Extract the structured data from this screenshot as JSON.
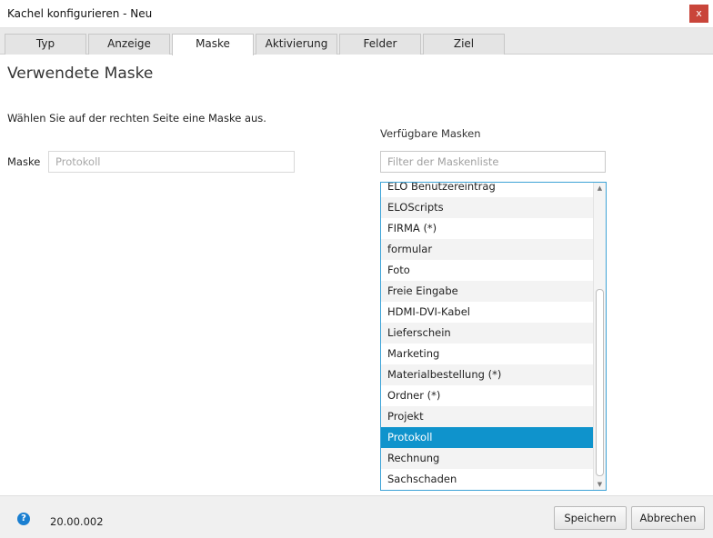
{
  "window": {
    "title": "Kachel konfigurieren - Neu",
    "close_label": "x"
  },
  "tabs": [
    {
      "label": "Typ"
    },
    {
      "label": "Anzeige"
    },
    {
      "label": "Maske"
    },
    {
      "label": "Aktivierung"
    },
    {
      "label": "Felder"
    },
    {
      "label": "Ziel"
    }
  ],
  "active_tab": "Maske",
  "page": {
    "title": "Verwendete Maske",
    "instruction": "Wählen Sie auf der rechten Seite eine Maske aus.",
    "mask_label": "Maske",
    "mask_value": "Protokoll",
    "available_label": "Verfügbare Masken",
    "filter_placeholder": "Filter der Maskenliste"
  },
  "mask_list": {
    "items": [
      "ELO Benutzereintrag",
      "ELOScripts",
      "FIRMA (*)",
      "formular",
      "Foto",
      "Freie Eingabe",
      "HDMI-DVI-Kabel",
      "Lieferschein",
      "Marketing",
      "Materialbestellung (*)",
      "Ordner (*)",
      "Projekt",
      "Protokoll",
      "Rechnung",
      "Sachschaden"
    ],
    "selected": "Protokoll"
  },
  "footer": {
    "help_icon": "question-circle-icon",
    "version": "20.00.002",
    "save_label": "Speichern",
    "cancel_label": "Abbrechen"
  },
  "colors": {
    "selection": "#0f93cc",
    "list_border": "#3da3d6",
    "close_button": "#c9453a",
    "help_icon": "#1a7fd1"
  }
}
